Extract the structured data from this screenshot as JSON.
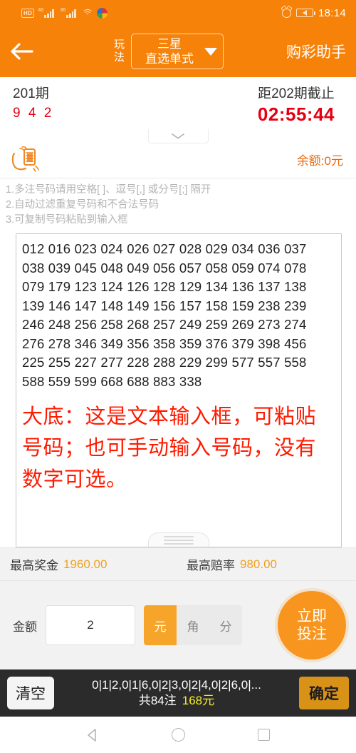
{
  "statusbar": {
    "hd_badge": "HD",
    "signal1_gen": "46",
    "signal2_gen": "36",
    "clock": "18:14"
  },
  "header": {
    "back_icon": "back-arrow-icon",
    "play_label": "玩法",
    "play_line1": "三星",
    "play_line2": "直选单式",
    "dropdown_icon": "chevron-down-icon",
    "assistant_label": "购彩助手"
  },
  "period": {
    "current_label": "201期",
    "winning_numbers": "9 4 2",
    "deadline_label": "距202期截止",
    "countdown": "02:55:44",
    "expand_icon": "chevron-down-icon"
  },
  "balance": {
    "money_icon": "hand-holding-money-icon",
    "text": "余额:0元"
  },
  "tips": [
    "1.多注号码请用空格[ ]、逗号[,] 或分号[;] 隔开",
    "2.自动过滤重复号码和不合法号码",
    "3.可复制号码粘贴到输入框"
  ],
  "input_area": {
    "numbers": "012 016 023 024 026 027 028 029 034 036 037\n038 039 045 048 049 056 057 058 059 074 078\n079 179 123 124 126 128 129 134 136 137 138\n139 146 147 148 149 156 157 158 159 238 239\n246 248 256 258 268 257 249 259 269 273 274\n276 278 346 349 356 358 359 376 379 398 456\n225 255 227 277 228 288 229 299 577 557 558\n588 559 599 668 688 883 338",
    "annotation": "大底：这是文本输入框，可粘贴号码；也可手动输入号码，没有数字可选。",
    "resize_handle": "resize-handle-icon"
  },
  "prize": {
    "max_prize_label": "最高奖金",
    "max_prize_value": "1960.00",
    "max_odds_label": "最高赔率",
    "max_odds_value": "980.00"
  },
  "amount": {
    "label": "金额",
    "value": "2",
    "placeholder": "2",
    "units": [
      {
        "label": "元",
        "active": true
      },
      {
        "label": "角",
        "active": false
      },
      {
        "label": "分",
        "active": false
      }
    ],
    "bet_line1": "立即",
    "bet_line2": "投注"
  },
  "bottombar": {
    "clear_label": "清空",
    "preview": "0|1|2,0|1|6,0|2|3,0|2|4,0|2|6,0|...",
    "count_text": "共84注",
    "total_amount": "168元",
    "confirm_label": "确定"
  },
  "navbar": {
    "back_icon": "android-back-icon",
    "home_icon": "android-home-icon",
    "recent_icon": "android-recents-icon"
  },
  "colors": {
    "brand_orange": "#F7820A",
    "accent_orange": "#F7951E",
    "red": "#e60012",
    "annotation_red": "#ff1a00",
    "gold": "#f0a020",
    "yellow": "#f2ec2a",
    "dark_bar": "#2b2b2b"
  }
}
